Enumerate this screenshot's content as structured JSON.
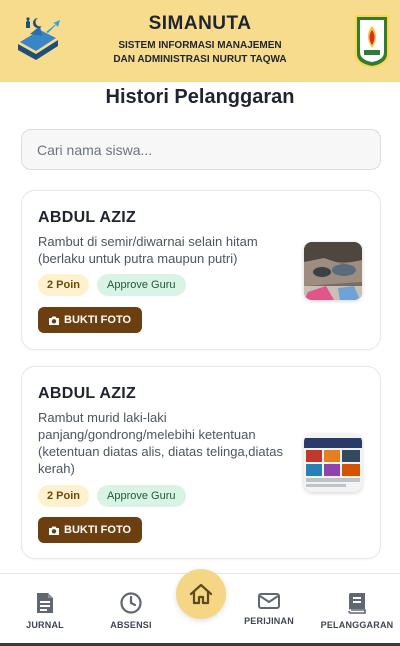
{
  "header": {
    "app_name": "SIMANUTA",
    "subtitle_line1": "SISTEM INFORMASI MANAJEMEN",
    "subtitle_line2": "DAN ADMINISTRASI NURUT TAQWA",
    "left_logo": "book-logo-icon",
    "right_logo": "school-crest-icon"
  },
  "page": {
    "title": "Histori Pelanggaran"
  },
  "search": {
    "placeholder": "Cari nama siswa...",
    "value": ""
  },
  "records": [
    {
      "name": "ABDUL AZIZ",
      "violation": "Rambut di semir/diwarnai selain hitam (berlaku untuk putra maupun putri)",
      "points": "2 Poin",
      "status": "Approve Guru",
      "button_label": "BUKTI FOTO"
    },
    {
      "name": "ABDUL AZIZ",
      "violation": "Rambut murid laki-laki panjang/gondrong/melebihi ketentuan (ketentuan diatas alis, diatas telinga,diatas kerah)",
      "points": "2 Poin",
      "status": "Approve Guru",
      "button_label": "BUKTI FOTO"
    }
  ],
  "nav": {
    "items": [
      {
        "label": "JURNAL",
        "icon": "document-icon"
      },
      {
        "label": "ABSENSI",
        "icon": "clock-icon"
      },
      {
        "label": "",
        "icon": "home-icon"
      },
      {
        "label": "PERIJINAN",
        "icon": "envelope-icon"
      },
      {
        "label": "PELANGGARAN",
        "icon": "book-icon"
      }
    ]
  },
  "colors": {
    "header_bg": "#f6dc8c",
    "button_brown": "#6b3f10",
    "badge_poin_bg": "#fdf1cf",
    "badge_status_bg": "#d9f4e4",
    "home_fab": "#f4d685"
  }
}
